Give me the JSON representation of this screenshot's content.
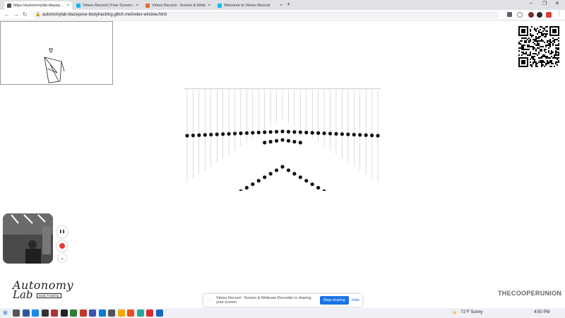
{
  "browser": {
    "tabs": [
      {
        "label": "https://autonomylab-blazep...",
        "favicon_color": "#4a4a4a",
        "active": true
      },
      {
        "label": "Vimeo Record | Free Screen & W...",
        "favicon_color": "#1ab7ea",
        "active": false
      },
      {
        "label": "Vimeo Record - Screen & Webca...",
        "favicon_color": "#e06b3b",
        "active": false
      },
      {
        "label": "Welcome to Vimeo Record",
        "favicon_color": "#1ab7ea",
        "active": false
      }
    ],
    "new_tab": "+",
    "close_glyph": "×",
    "url": "autonomylab-blazepose-bodytracking.glitch.me/index-window.html",
    "window_controls": {
      "minimize": "–",
      "maximize": "❐",
      "close": "✕"
    },
    "nav": {
      "back": "←",
      "forward": "→",
      "reload": "↻"
    }
  },
  "qr_label": "",
  "controls": {
    "pause": "❚❚",
    "collapse": "⌄"
  },
  "logo": {
    "line1": "Autonomy",
    "line2": "Lab",
    "tag": "Body Tracking"
  },
  "institution": "THECOOPERUNION",
  "share_bar": {
    "drag": "⋮⋮",
    "message": "Vimeo Record - Screen & Webcam Recorder is sharing your screen.",
    "stop": "Stop sharing",
    "hide": "Hide"
  },
  "taskbar": {
    "apps": [
      "#555",
      "#2b5797",
      "#1e88e5",
      "#333",
      "#a33",
      "#222",
      "#2e7d32",
      "#c0392b",
      "#3f51b5",
      "#0b7ad1",
      "#555",
      "#f2a900",
      "#e94e1b",
      "#26a69a",
      "#d32f2f",
      "#1565c0"
    ],
    "weather": "71°F  Sunny",
    "time": "4:50 PM"
  },
  "colors": {
    "accent": "#1a73e8",
    "record": "#e53935"
  }
}
